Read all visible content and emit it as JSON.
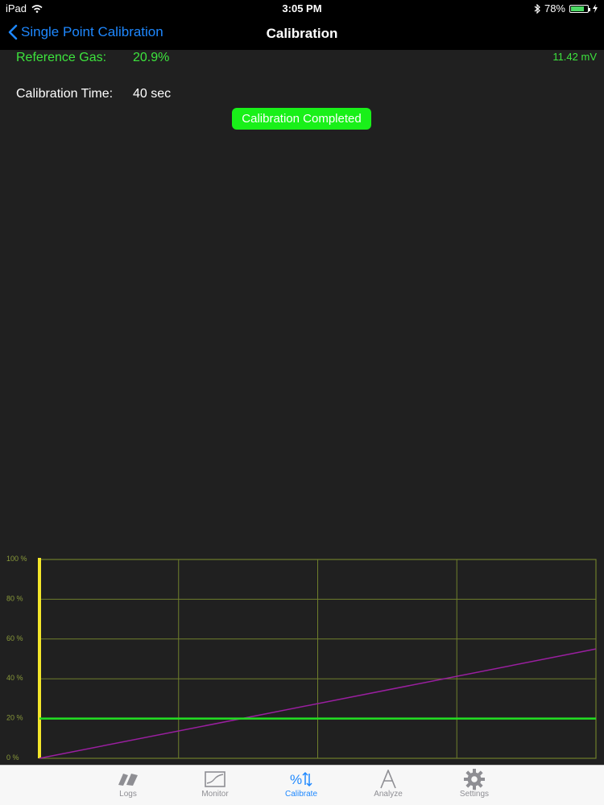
{
  "status_bar": {
    "device": "iPad",
    "time": "3:05 PM",
    "battery": "78%",
    "battery_level": 0.78
  },
  "nav": {
    "back_label": "Single Point Calibration",
    "title": "Calibration"
  },
  "calibration": {
    "reference_gas_label": "Reference Gas:",
    "reference_gas_value": "20.9%",
    "millivolts": "11.42 mV",
    "time_label": "Calibration Time:",
    "time_value": "40 sec",
    "status": "Calibration Completed"
  },
  "chart_data": {
    "type": "line",
    "y_tick_labels": [
      "0 %",
      "20 %",
      "40 %",
      "60 %",
      "80 %",
      "100 %"
    ],
    "ylim": [
      0,
      100
    ],
    "xlim": [
      0,
      1
    ],
    "grid": true,
    "series": [
      {
        "color": "#9a1fa0",
        "x": [
          0,
          1
        ],
        "y": [
          0,
          55
        ]
      },
      {
        "color": "#22e022",
        "x": [
          0,
          1
        ],
        "y": [
          20,
          20
        ]
      }
    ]
  },
  "tabs": [
    {
      "label": "Logs",
      "icon": "logs-icon",
      "active": false
    },
    {
      "label": "Monitor",
      "icon": "monitor-icon",
      "active": false
    },
    {
      "label": "Calibrate",
      "icon": "calibrate-icon",
      "active": true
    },
    {
      "label": "Analyze",
      "icon": "analyze-icon",
      "active": false
    },
    {
      "label": "Settings",
      "icon": "gear-icon",
      "active": false
    }
  ]
}
